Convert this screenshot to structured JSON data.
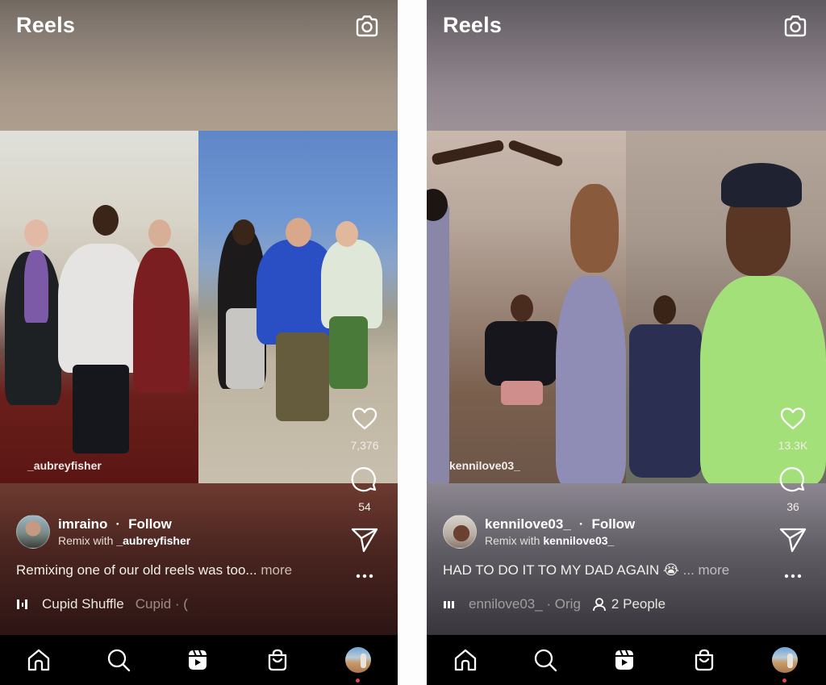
{
  "screens": [
    {
      "header": {
        "title": "Reels",
        "camera_icon": "camera-icon"
      },
      "video": {
        "credit": "_aubreyfisher"
      },
      "actions": {
        "like_count": "7,376",
        "comment_count": "54"
      },
      "author": {
        "username": "imraino",
        "follow_label": "Follow",
        "separator": "·",
        "remix_prefix": "Remix with",
        "remix_user": "_aubreyfisher"
      },
      "caption": {
        "text": "Remixing one of our old reels was too...",
        "more": "more"
      },
      "audio": {
        "track": "Cupid Shuffle",
        "artist": "Cupid · ("
      }
    },
    {
      "header": {
        "title": "Reels",
        "camera_icon": "camera-icon"
      },
      "video": {
        "credit": "kennilove03_"
      },
      "actions": {
        "like_count": "13.3K",
        "comment_count": "36"
      },
      "author": {
        "username": "kennilove03_",
        "follow_label": "Follow",
        "separator": "·",
        "remix_prefix": "Remix with",
        "remix_user": "kennilove03_"
      },
      "caption": {
        "text": "HAD TO DO IT TO MY DAD AGAIN 😭",
        "more": "... more"
      },
      "audio": {
        "track": "ennilove03_ · Orig",
        "people": "2 People"
      }
    }
  ],
  "nav": {
    "items": [
      "home",
      "search",
      "reels",
      "shop",
      "profile"
    ],
    "notification_color": "#e0455a"
  }
}
